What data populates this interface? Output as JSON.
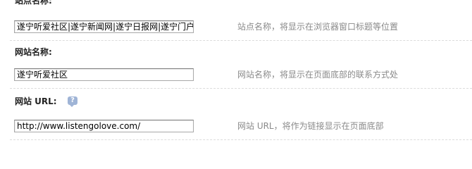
{
  "site_name": {
    "label": "站点名称:",
    "value": "遂宁听爱社区|遂宁新闻网|遂宁日报网|遂宁门户",
    "hint": "站点名称，将显示在浏览器窗口标题等位置"
  },
  "website_name": {
    "label": "网站名称:",
    "value": "遂宁听爱社区",
    "hint": "网站名称，将显示在页面底部的联系方式处"
  },
  "website_url": {
    "label": "网站 URL:",
    "help_icon_glyph": "?",
    "value": "http://www.listengolove.com/",
    "hint": "网站 URL，将作为链接显示在页面底部"
  }
}
